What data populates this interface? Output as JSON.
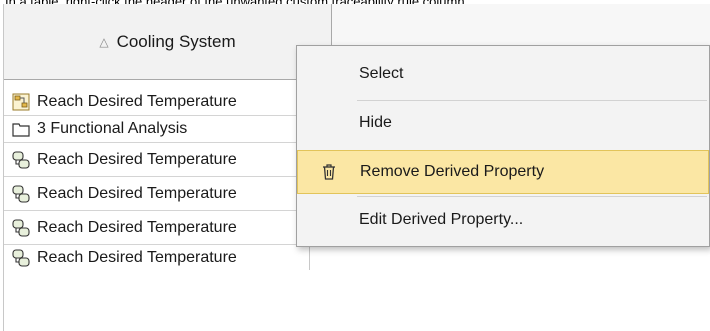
{
  "caption": "In a table, right-click the header of the unwanted custom traceability rule column.",
  "table": {
    "column_header": "Cooling System",
    "sort_icon": "triangle-up-icon",
    "rows": [
      {
        "icon": "diagram-icon",
        "text": "Reach Desired Temperature"
      },
      {
        "icon": "folder-icon",
        "text": "3 Functional Analysis"
      },
      {
        "icon": "activity-icon",
        "text": "Reach Desired Temperature"
      },
      {
        "icon": "activity-icon",
        "text": "Reach Desired Temperature"
      },
      {
        "icon": "activity-icon",
        "text": "Reach Desired Temperature"
      },
      {
        "icon": "activity-icon",
        "text": "Reach Desired Temperature"
      }
    ]
  },
  "context_menu": {
    "items": [
      {
        "label": "Select",
        "icon": null,
        "highlighted": false
      },
      {
        "label": "Hide",
        "icon": null,
        "highlighted": false
      },
      {
        "label": "Remove Derived Property",
        "icon": "trash-icon",
        "highlighted": true
      },
      {
        "label": "Edit Derived Property...",
        "icon": null,
        "highlighted": false
      }
    ]
  },
  "colors": {
    "highlight": "#fbe7a4",
    "highlight_border": "#e2c45a",
    "menu_bg": "#f3f3f3",
    "header_bg": "#f2f2f2"
  }
}
